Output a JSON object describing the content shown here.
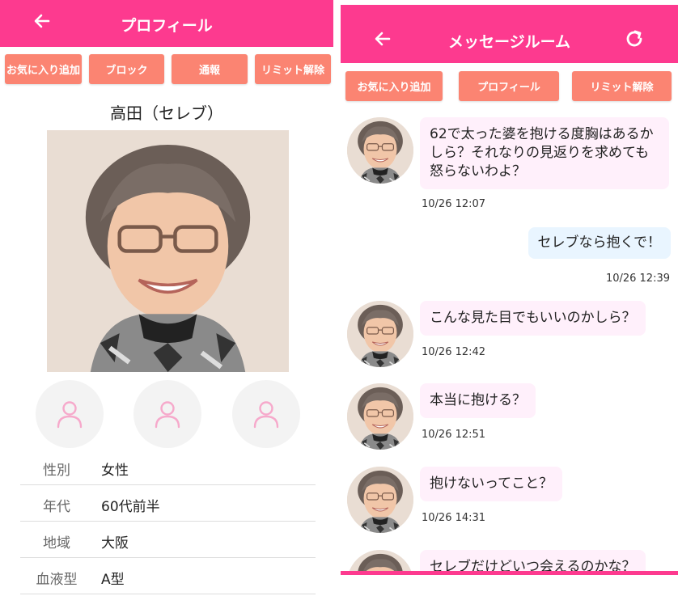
{
  "colors": {
    "primary": "#fd3a8f",
    "button": "#fb8472",
    "incoming_bubble": "#fff0fb",
    "outgoing_bubble": "#e9f5ff"
  },
  "profile": {
    "header": {
      "title": "プロフィール",
      "back_icon": "arrow-left-icon"
    },
    "buttons": [
      "お気に入り追加",
      "ブロック",
      "通報",
      "リミット解除"
    ],
    "name": "高田（セレブ）",
    "photo_slot_icon": "person-outline-icon",
    "info": [
      {
        "label": "性別",
        "value": "女性"
      },
      {
        "label": "年代",
        "value": "60代前半"
      },
      {
        "label": "地域",
        "value": "大阪"
      },
      {
        "label": "血液型",
        "value": "A型"
      }
    ]
  },
  "chat": {
    "header": {
      "title": "メッセージルーム",
      "back_icon": "arrow-left-icon",
      "refresh_icon": "refresh-icon"
    },
    "buttons": [
      "お気に入り追加",
      "プロフィール",
      "リミット解除"
    ],
    "messages": [
      {
        "from": "them",
        "text": "62で太った婆を抱ける度胸はあるかしら？それなりの見返りを求めても怒らないわよ？",
        "time": "10/26 12:07"
      },
      {
        "from": "me",
        "text": "セレブなら抱くで！",
        "time": "10/26 12:39"
      },
      {
        "from": "them",
        "text": "こんな見た目でもいいのかしら？",
        "time": "10/26 12:42"
      },
      {
        "from": "them",
        "text": "本当に抱ける？",
        "time": "10/26 12:51"
      },
      {
        "from": "them",
        "text": "抱けないってこと？",
        "time": "10/26 14:31"
      },
      {
        "from": "them",
        "text": "セレブだけどいつ会えるのかな？",
        "time": ""
      }
    ]
  }
}
